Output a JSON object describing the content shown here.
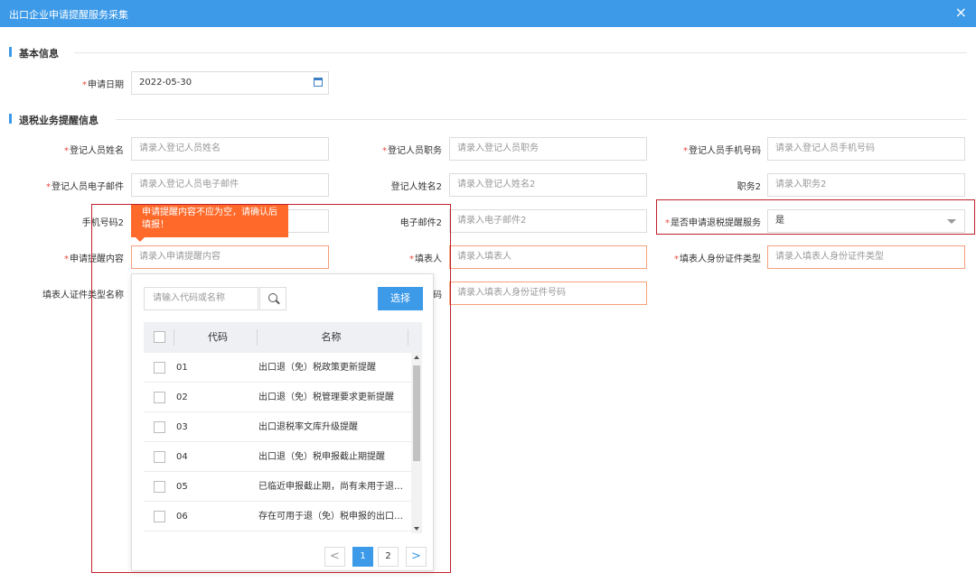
{
  "window": {
    "title": "出口企业申请提醒服务采集",
    "close_icon": "×"
  },
  "section_basic": {
    "title": "基本信息"
  },
  "section_refund": {
    "title": "退税业务提醒信息"
  },
  "fields": {
    "apply_date": {
      "label": "申请日期",
      "value": "2022-05-30"
    },
    "reg_name": {
      "label": "登记人员姓名",
      "placeholder": "请录入登记人员姓名"
    },
    "reg_duty": {
      "label": "登记人员职务",
      "placeholder": "请录入登记人员职务"
    },
    "reg_phone": {
      "label": "登记人员手机号码",
      "placeholder": "请录入登记人员手机号码"
    },
    "reg_email": {
      "label": "登记人员电子邮件",
      "placeholder": "请录入登记人员电子邮件"
    },
    "reg_name2": {
      "label": "登记人姓名2",
      "placeholder": "请录入登记人姓名2"
    },
    "duty2": {
      "label": "职务2",
      "placeholder": "请录入职务2"
    },
    "phone2": {
      "label": "手机号码2"
    },
    "email2": {
      "label": "电子邮件2",
      "placeholder": "请录入电子邮件2"
    },
    "apply_service": {
      "label": "是否申请退税提醒服务",
      "value": "是"
    },
    "remind_content": {
      "label": "申请提醒内容",
      "placeholder": "请录入申请提醒内容"
    },
    "filler": {
      "label": "填表人",
      "placeholder": "请录入填表人"
    },
    "filler_id_type": {
      "label": "填表人身份证件类型",
      "placeholder": "请录入填表人身份证件类型"
    },
    "filler_id_type_name": {
      "label": "填表人证件类型名称"
    },
    "filler_id_no": {
      "label_suffix": "码",
      "placeholder": "请录入填表人身份证件号码"
    }
  },
  "tooltip": {
    "text": "申请提醒内容不应为空，请确认后填报！"
  },
  "dropdown": {
    "search_placeholder": "请输入代码或名称",
    "choose_label": "选择",
    "col_code": "代码",
    "col_name": "名称",
    "rows": [
      {
        "code": "01",
        "name": "出口退（免）税政策更新提醒"
      },
      {
        "code": "02",
        "name": "出口退（免）税管理要求更新提醒"
      },
      {
        "code": "03",
        "name": "出口退税率文库升级提醒"
      },
      {
        "code": "04",
        "name": "出口退（免）税申报截止期提醒"
      },
      {
        "code": "05",
        "name": "已临近申报截止期，尚有未用于退（免）税申报的出口报关单提醒"
      },
      {
        "code": "06",
        "name": "存在可用于退（免）税申报的出口货物报关单提醒"
      }
    ],
    "pagination": {
      "prev": "<",
      "next": ">",
      "pages": [
        "1",
        "2"
      ],
      "current": "1"
    }
  },
  "colors": {
    "accent": "#3c9ae8",
    "error": "#ff6a2b",
    "required": "#e94a3f",
    "highlight": "#c0202a"
  }
}
